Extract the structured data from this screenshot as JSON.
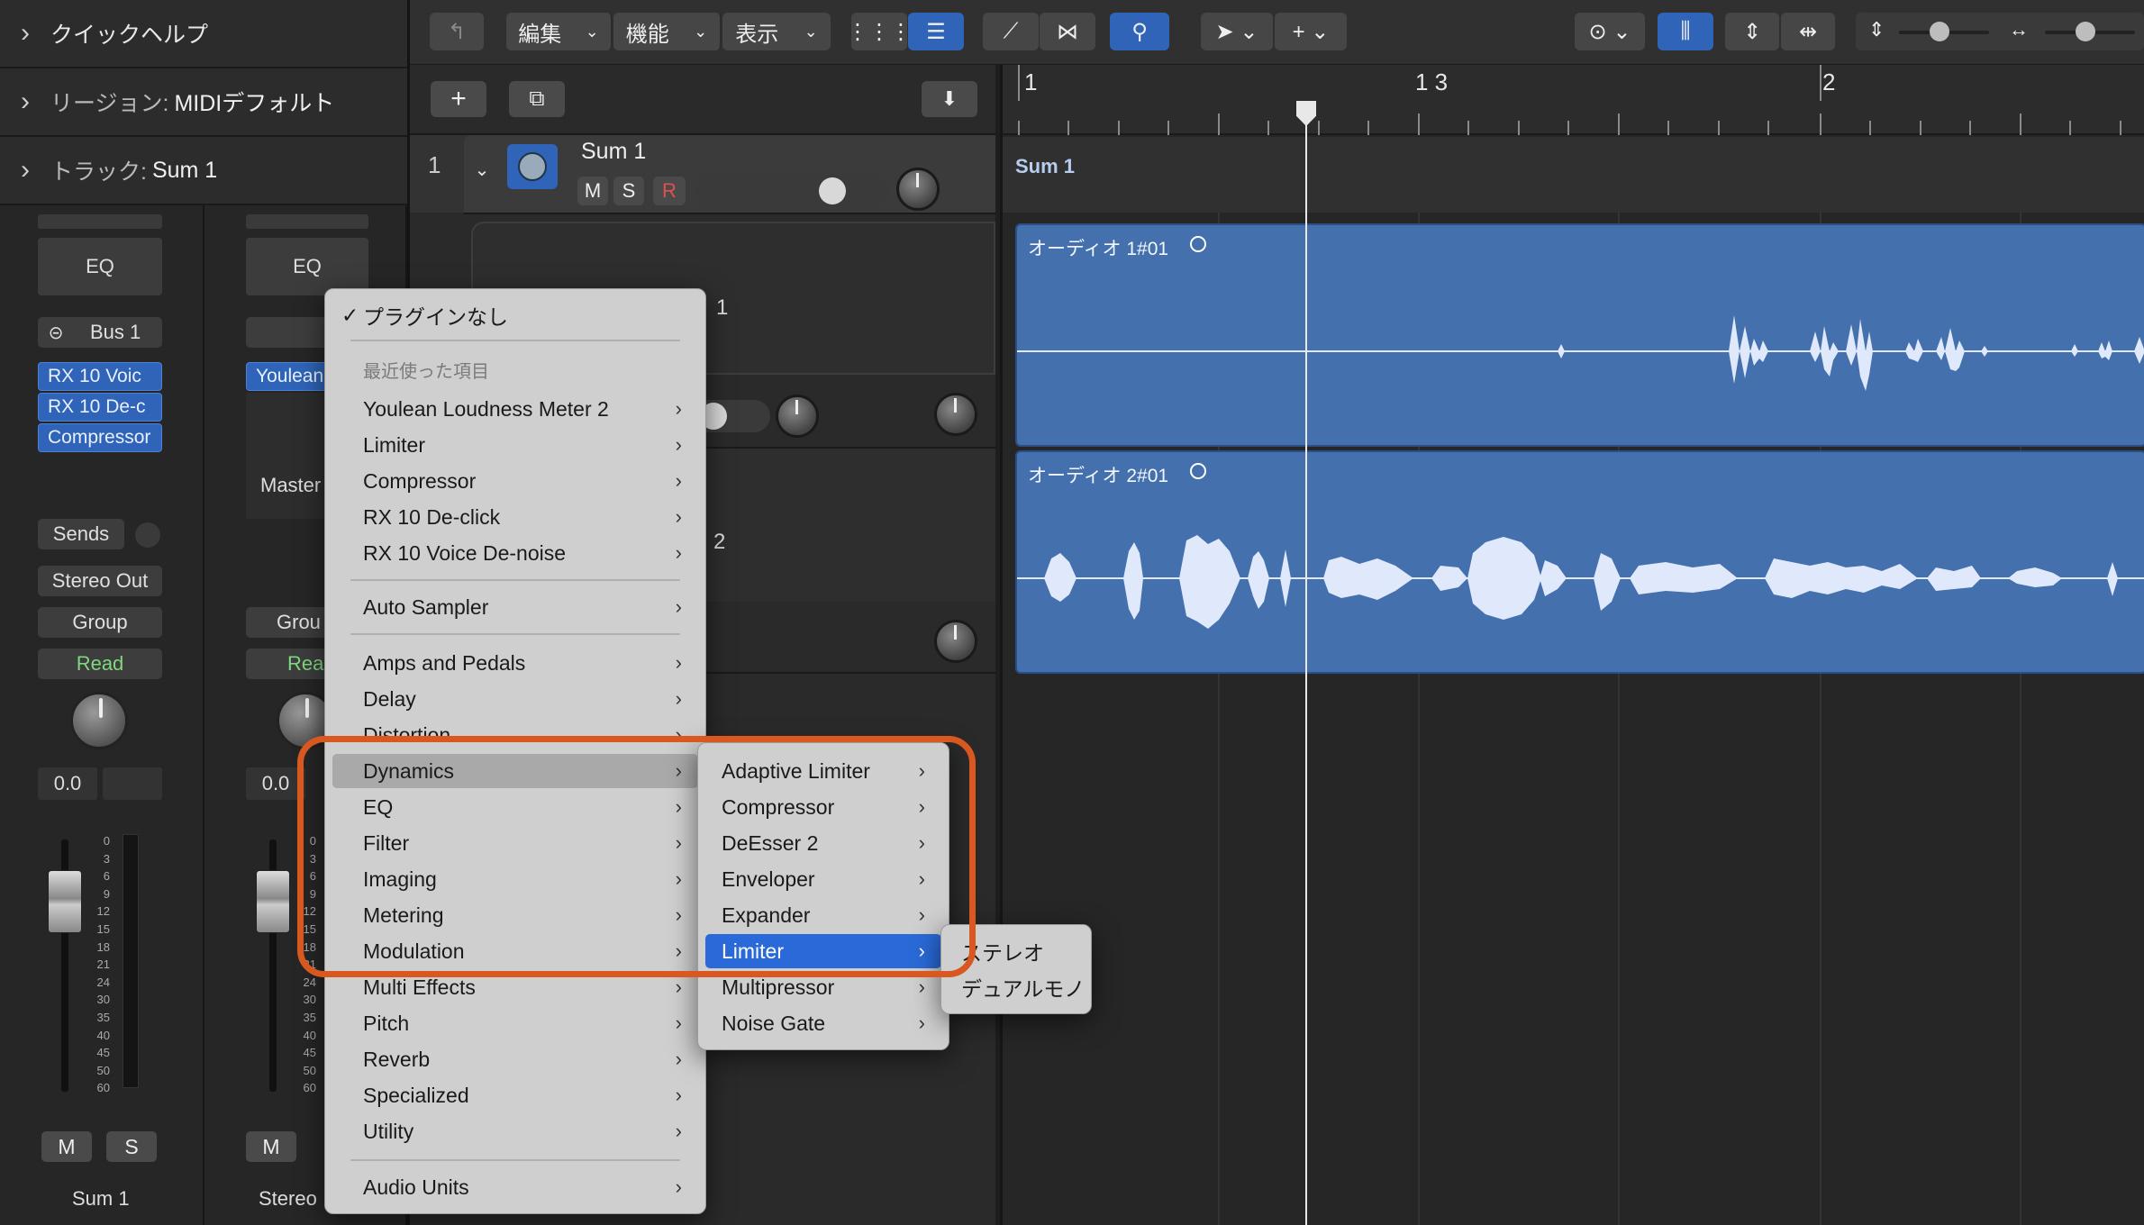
{
  "inspector": {
    "rows": [
      {
        "label": "クイックヘルプ",
        "value": ""
      },
      {
        "label": "リージョン:",
        "value": "MIDIデフォルト"
      },
      {
        "label": "トラック:",
        "value": "Sum 1"
      }
    ]
  },
  "channel_strips": [
    {
      "eq_label": "EQ",
      "link_label": "Bus 1",
      "plugins": [
        "RX 10 Voic",
        "RX 10 De-c",
        "Compressor"
      ],
      "sends_label": "Sends",
      "output_label": "Stereo Out",
      "group_label": "Group",
      "automation_label": "Read",
      "volume": "0.0",
      "mute": "M",
      "solo": "S",
      "name": "Sum 1"
    },
    {
      "eq_label": "EQ",
      "plugins": [
        "Youlean"
      ],
      "master_label": "Master",
      "group_label": "Grou",
      "automation_label": "Read",
      "volume": "0.0",
      "mute": "M",
      "name": "Stereo"
    }
  ],
  "meter_scale": [
    "0",
    "3",
    "6",
    "9",
    "12",
    "15",
    "18",
    "21",
    "24",
    "30",
    "35",
    "40",
    "45",
    "50",
    "60"
  ],
  "toolbar": {
    "menus": [
      "編集",
      "機能",
      "表示"
    ]
  },
  "tracks": [
    {
      "number": "1",
      "name": "Sum 1",
      "mute": "M",
      "solo": "S",
      "record": "R"
    },
    {
      "partial_name": "1"
    },
    {
      "partial_name": "2"
    }
  ],
  "ruler": {
    "marks": [
      "1",
      "1 3",
      "2"
    ]
  },
  "regions": [
    {
      "name": "Sum 1"
    },
    {
      "name": "オーディオ 1#01"
    },
    {
      "name": "オーディオ 2#01"
    }
  ],
  "plugin_menu": {
    "no_plugin": "プラグインなし",
    "recent_header": "最近使った項目",
    "recent": [
      "Youlean Loudness Meter 2",
      "Limiter",
      "Compressor",
      "RX 10 De-click",
      "RX 10 Voice De-noise"
    ],
    "auto_sampler": "Auto Sampler",
    "categories_a": [
      "Amps and Pedals",
      "Delay",
      "Distortion"
    ],
    "categories_b": [
      "Dynamics",
      "EQ",
      "Filter",
      "Imaging",
      "Metering",
      "Modulation",
      "Multi Effects",
      "Pitch",
      "Reverb",
      "Specialized",
      "Utility"
    ],
    "audio_units": "Audio Units"
  },
  "dynamics_submenu": [
    "Adaptive Limiter",
    "Compressor",
    "DeEsser 2",
    "Enveloper",
    "Expander",
    "Limiter",
    "Multipressor",
    "Noise Gate"
  ],
  "limiter_submenu": [
    "ステレオ",
    "デュアルモノ"
  ]
}
